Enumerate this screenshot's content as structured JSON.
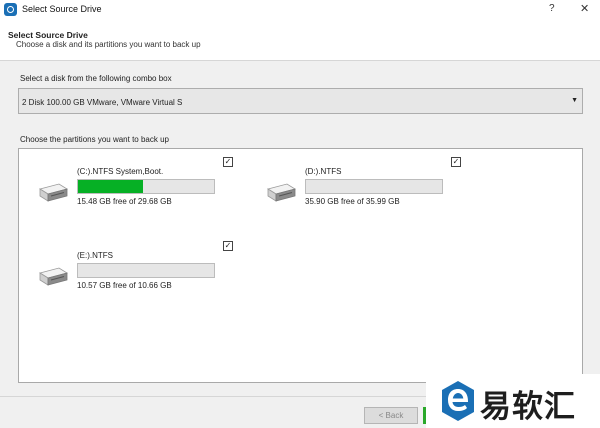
{
  "window": {
    "title": "Select Source Drive",
    "help_label": "?",
    "close_label": "✕"
  },
  "header": {
    "title": "Select Source Drive",
    "subtitle": "Choose a disk and its partitions you want to back up"
  },
  "disk": {
    "label": "Select a disk from the following combo box",
    "selected": "2 Disk 100.00 GB VMware,  VMware Virtual S",
    "arrow": "▼"
  },
  "partitions": {
    "label": "Choose the partitions you want to back up",
    "items": [
      {
        "name": "(C:).NTFS System,Boot.",
        "free": "15.48 GB free of 29.68 GB",
        "used_fraction": 0.48,
        "checked": true,
        "check_mark": "✓"
      },
      {
        "name": "(D:).NTFS",
        "free": "35.90 GB free of 35.99 GB",
        "used_fraction": 0.0,
        "checked": true,
        "check_mark": "✓"
      },
      {
        "name": "(E:).NTFS",
        "free": "10.57 GB free of 10.66 GB",
        "used_fraction": 0.0,
        "checked": true,
        "check_mark": "✓"
      }
    ]
  },
  "footer": {
    "back_label": "< Back"
  },
  "watermark": {
    "text": "易软汇"
  },
  "colors": {
    "progress": "#06b025",
    "logo_blue": "#1a6fb5"
  }
}
